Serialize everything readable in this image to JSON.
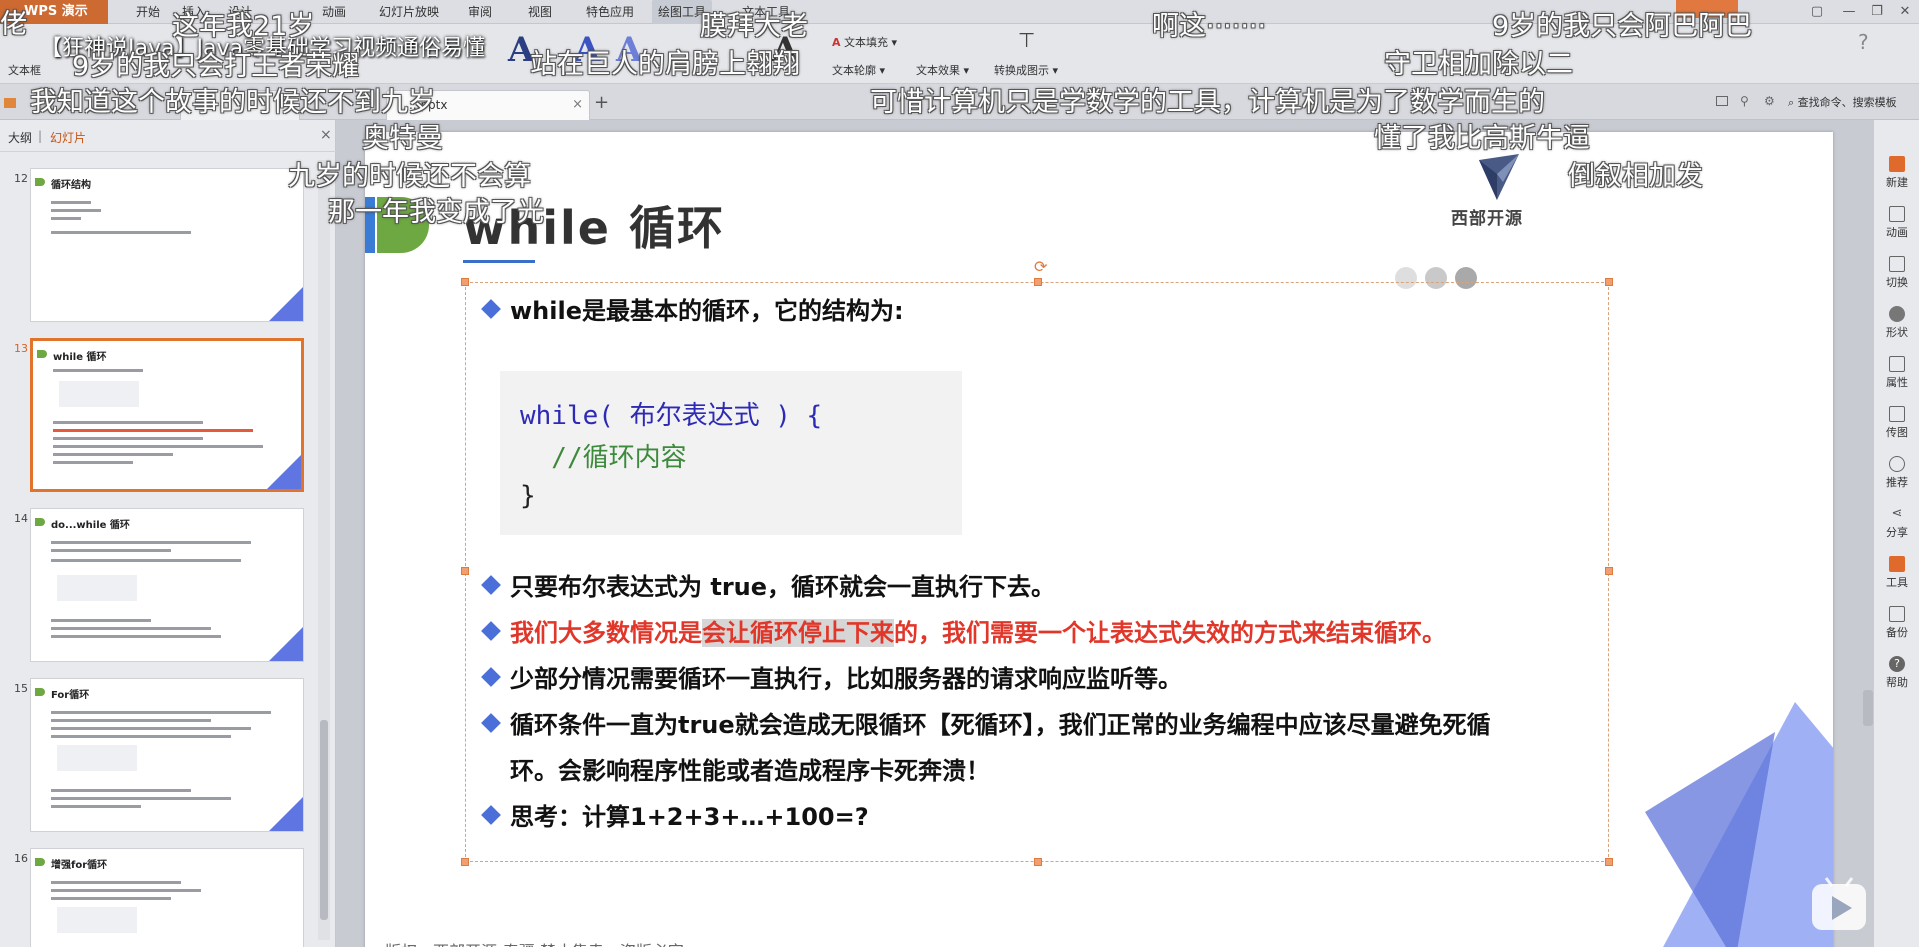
{
  "app": {
    "name": "WPS 演示",
    "menu": [
      "开始",
      "插入",
      "设计",
      "动画",
      "幻灯片放映",
      "审阅",
      "视图",
      "特色应用",
      "绘图工具",
      "文本工具"
    ],
    "active_menu": "绘图工具"
  },
  "ribbon": {
    "text_box_label": "文本框",
    "text_fill": "文本填充",
    "text_outline": "文本轮廓",
    "text_effects": "文本效果",
    "convert_to_diagram": "转换成图示"
  },
  "tabs": [
    {
      "label": "",
      "active": false
    },
    {
      "label": "",
      "active": false
    },
    {
      "label": "...pptx",
      "active": true
    }
  ],
  "search_command": "查找命令、搜索模板",
  "left_panel": {
    "tab_outline": "大纲",
    "tab_sep": "|",
    "tab_slides": "幻灯片",
    "close": "×",
    "thumbnails": [
      {
        "num": "12",
        "title": "循环结构",
        "selected": false
      },
      {
        "num": "13",
        "title": "while 循环",
        "selected": true
      },
      {
        "num": "14",
        "title": "do...while 循环",
        "selected": false
      },
      {
        "num": "15",
        "title": "For循环",
        "selected": false
      },
      {
        "num": "16",
        "title": "增强for循环",
        "selected": false
      }
    ]
  },
  "slide": {
    "title": "while 循环",
    "brand": "西部开源",
    "intro": "while是最基本的循环，它的结构为:",
    "code": [
      "while( 布尔表达式 ) {",
      "  //循环内容",
      "}"
    ],
    "bullets": [
      "只要布尔表达式为 true，循环就会一直执行下去。",
      "我们大多数情况是会让循环停止下来的，我们需要一个让表达式失效的方式来结束循环。",
      "少部分情况需要循环一直执行，比如服务器的请求响应监听等。",
      "循环条件一直为true就会造成无限循环【死循环】，我们正常的业务编程中应该尽量避免死循",
      "环。会影响程序性能或者造成程序卡死奔溃！",
      "思考：计算1+2+3+…+100=?"
    ],
    "red_bullet_prefix": "我们大多数情况是",
    "red_bullet_highlight": "会让循环停止下来",
    "red_bullet_suffix": "的，我们需要一个让表达式失效的方式来结束循环。",
    "copyright": "版权：西部开源-秦疆    禁止售卖，盗版必究",
    "colors": {
      "accent_blue": "#4a6fd9",
      "red_text": "#e0372a",
      "green": "#6ea842"
    }
  },
  "right_sidebar": [
    "新建",
    "动画",
    "切换",
    "形状",
    "属性",
    "传图",
    "推荐",
    "分享",
    "工具",
    "备份",
    "帮助"
  ],
  "video_title": "【狂神说Java】Java零基础学习视频通俗易懂",
  "danmaku": [
    "佬",
    "这年我21岁",
    "膜拜大老",
    "啊这·······",
    "9岁的我只会阿巴阿巴",
    "9岁的我只会打王者荣耀",
    "站在巨人的肩膀上翱翔",
    "守卫相加除以二",
    "我知道这个故事的时候还不到九岁",
    "可惜计算机只是学数学的工具，计算机是为了数学而生的",
    "奥特曼",
    "懂了我比高斯牛逼",
    "九岁的时候还不会算",
    "倒叙相加发",
    "那一年我变成了光"
  ]
}
